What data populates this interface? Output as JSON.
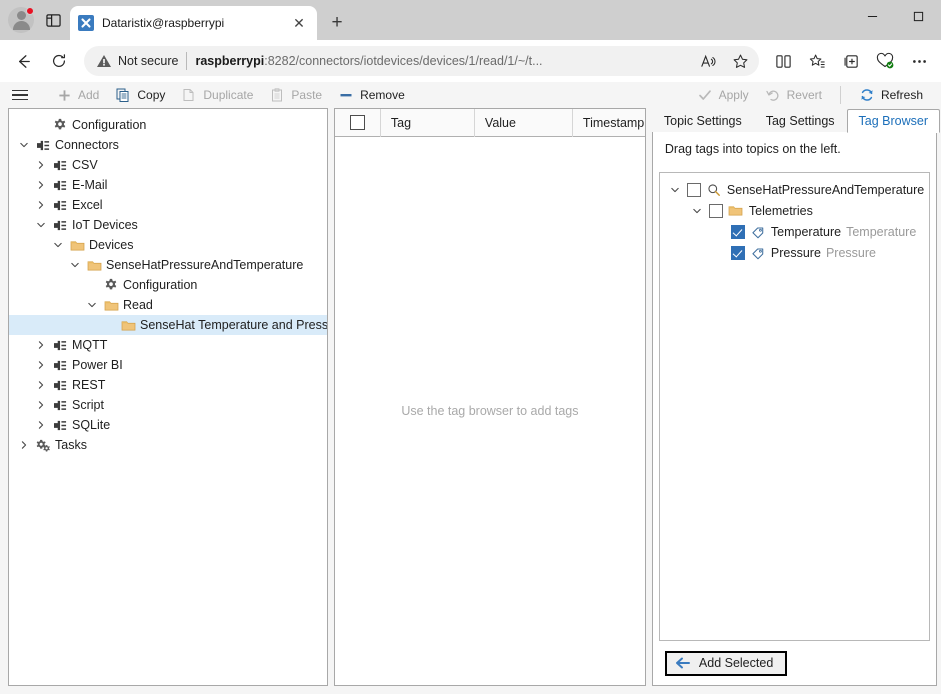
{
  "browser": {
    "tab": {
      "title": "Dataristix@raspberrypi",
      "favicon": "dataristix-favicon",
      "close_label": "✕"
    },
    "new_tab_label": "+",
    "window_controls": {
      "minimize": "—",
      "maximize": "□"
    },
    "nav": {
      "back": "←",
      "reload": "↻"
    },
    "omnibox": {
      "security_label": "Not secure",
      "url_host": "raspberrypi",
      "url_rest": ":8282/connectors/iotdevices/devices/1/read/1/~/t...",
      "read_aloud_icon": "read-aloud-icon",
      "favorite_icon": "star-icon"
    },
    "toolbar_icons": [
      "split-screen-icon",
      "favorites-icon",
      "collections-icon",
      "browser-essentials-icon",
      "settings-more-icon"
    ]
  },
  "app_toolbar": {
    "menu_icon": "hamburger-menu-icon",
    "items": [
      {
        "label": "Add",
        "icon": "plus-icon",
        "disabled": true
      },
      {
        "label": "Copy",
        "icon": "copy-icon",
        "disabled": false
      },
      {
        "label": "Duplicate",
        "icon": "duplicate-icon",
        "disabled": true
      },
      {
        "label": "Paste",
        "icon": "paste-icon",
        "disabled": true
      },
      {
        "label": "Remove",
        "icon": "minus-icon",
        "disabled": false
      }
    ],
    "right_items": [
      {
        "label": "Apply",
        "icon": "check-icon",
        "disabled": true
      },
      {
        "label": "Revert",
        "icon": "undo-icon",
        "disabled": true
      },
      {
        "label": "Refresh",
        "icon": "refresh-icon",
        "disabled": false
      }
    ]
  },
  "tree": {
    "nodes": [
      {
        "label": "Configuration",
        "indent": 1,
        "chevron": "none",
        "icon": "gear-icon",
        "selected": false
      },
      {
        "label": "Connectors",
        "indent": 0,
        "chevron": "down",
        "icon": "plug-icon",
        "selected": false
      },
      {
        "label": "CSV",
        "indent": 1,
        "chevron": "right",
        "icon": "plug-icon",
        "selected": false
      },
      {
        "label": "E-Mail",
        "indent": 1,
        "chevron": "right",
        "icon": "plug-icon",
        "selected": false
      },
      {
        "label": "Excel",
        "indent": 1,
        "chevron": "right",
        "icon": "plug-icon",
        "selected": false
      },
      {
        "label": "IoT Devices",
        "indent": 1,
        "chevron": "down",
        "icon": "plug-icon",
        "selected": false
      },
      {
        "label": "Devices",
        "indent": 2,
        "chevron": "down",
        "icon": "folder-icon",
        "selected": false
      },
      {
        "label": "SenseHatPressureAndTemperature",
        "indent": 3,
        "chevron": "down",
        "icon": "folder-icon",
        "selected": false
      },
      {
        "label": "Configuration",
        "indent": 4,
        "chevron": "none",
        "icon": "gear-icon",
        "selected": false
      },
      {
        "label": "Read",
        "indent": 4,
        "chevron": "down",
        "icon": "folder-icon",
        "selected": false
      },
      {
        "label": "SenseHat Temperature and Pressure",
        "indent": 5,
        "chevron": "none",
        "icon": "folder-icon",
        "selected": true
      },
      {
        "label": "MQTT",
        "indent": 1,
        "chevron": "right",
        "icon": "plug-icon",
        "selected": false
      },
      {
        "label": "Power BI",
        "indent": 1,
        "chevron": "right",
        "icon": "plug-icon",
        "selected": false
      },
      {
        "label": "REST",
        "indent": 1,
        "chevron": "right",
        "icon": "plug-icon",
        "selected": false
      },
      {
        "label": "Script",
        "indent": 1,
        "chevron": "right",
        "icon": "plug-icon",
        "selected": false
      },
      {
        "label": "SQLite",
        "indent": 1,
        "chevron": "right",
        "icon": "plug-icon",
        "selected": false
      },
      {
        "label": "Tasks",
        "indent": 0,
        "chevron": "right",
        "icon": "tasks-gears-icon",
        "selected": false
      }
    ]
  },
  "tag_table": {
    "columns": [
      "Tag",
      "Value",
      "Timestamp"
    ],
    "select_all_checked": false,
    "rows": [],
    "empty_message": "Use the tag browser to add tags"
  },
  "right_panel": {
    "tabs": [
      {
        "label": "Topic Settings",
        "active": false
      },
      {
        "label": "Tag Settings",
        "active": false
      },
      {
        "label": "Tag Browser",
        "active": true
      }
    ],
    "hint": "Drag tags into topics on the left.",
    "browser_tree": [
      {
        "label": "SenseHatPressureAndTemperature",
        "desc": "",
        "indent": 0,
        "chevron": "down",
        "icon": "search-icon",
        "checkbox": "unchecked"
      },
      {
        "label": "Telemetries",
        "desc": "",
        "indent": 1,
        "chevron": "down",
        "icon": "folder-icon",
        "checkbox": "unchecked"
      },
      {
        "label": "Temperature",
        "desc": "Temperature",
        "indent": 2,
        "chevron": "none",
        "icon": "tag-icon",
        "checkbox": "checked"
      },
      {
        "label": "Pressure",
        "desc": "Pressure",
        "indent": 2,
        "chevron": "none",
        "icon": "tag-icon",
        "checkbox": "checked"
      }
    ],
    "add_selected_button": {
      "label": "Add Selected",
      "icon": "arrow-left-icon"
    }
  },
  "colors": {
    "accent_blue": "#1c6fba",
    "selection_blue": "#d9ebf9",
    "folder_yellow": "#e8b961",
    "checkbox_blue": "#2f6fb5",
    "chrome_gray": "#cfcfcf",
    "app_gray": "#f5f5f5"
  }
}
